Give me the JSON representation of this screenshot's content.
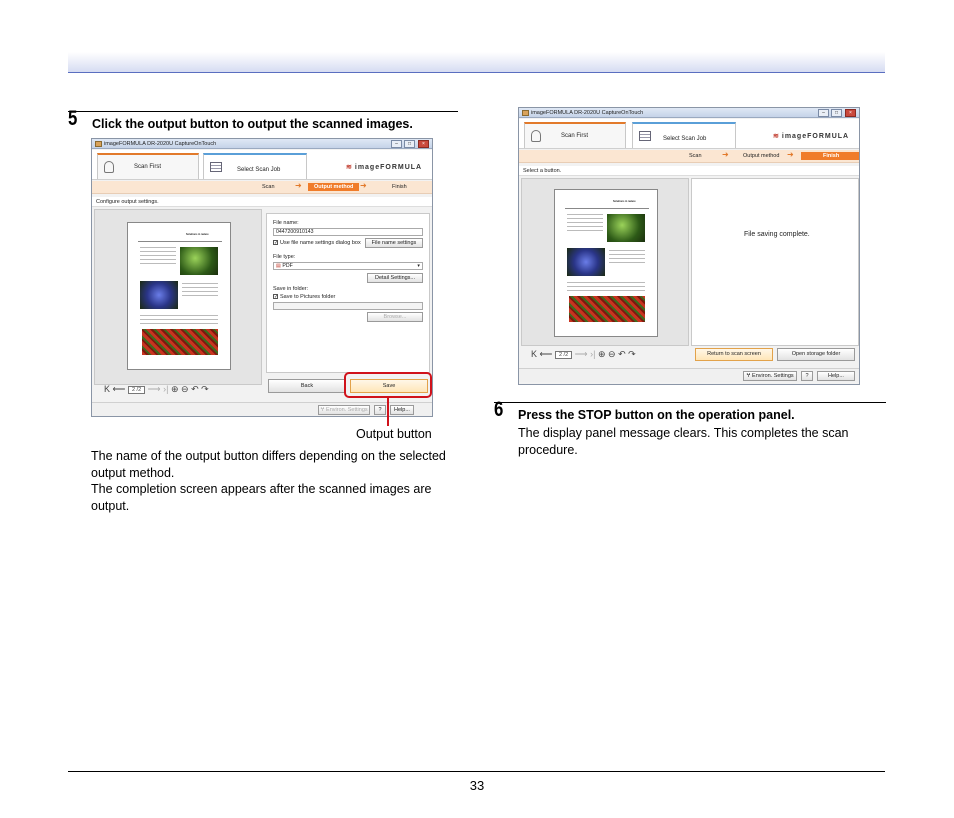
{
  "page": {
    "number": "33"
  },
  "step5": {
    "number": "5",
    "title": "Click the output button to output the scanned images.",
    "callout": "Output button",
    "body": [
      "The name of the output button differs depending on the selected",
      "output method.",
      "The completion screen appears after the scanned images are",
      "output."
    ],
    "screenshot": {
      "window_title": "imageFORMULA DR-2020U CaptureOnTouch",
      "tabs": [
        "Scan First",
        "Select Scan Job"
      ],
      "logo": "imageFORMULA",
      "steps": [
        "Scan",
        "Output method",
        "Finish"
      ],
      "instruction": "Configure output settings.",
      "file_name_label": "File name:",
      "file_name_value": "0447200910143",
      "use_dialog_label": "Use file name settings dialog box",
      "file_name_settings_btn": "File name settings",
      "file_type_label": "File type:",
      "file_type_value": "PDF",
      "detail_settings_btn": "Detail Settings...",
      "save_in_label": "Save in folder:",
      "save_to_pictures_label": "Save to Pictures folder",
      "browse_btn": "Browse...",
      "back_btn": "Back",
      "save_btn": "Save",
      "environ_btn": "Environ. Settings",
      "help_q": "?",
      "help_btn": "Help...",
      "page_counter": "2 /2",
      "doc_heading": "Solutions in nature"
    }
  },
  "step6": {
    "number": "6",
    "title": "Press the STOP button on the operation panel.",
    "body": [
      "The display panel message clears. This completes the scan",
      "procedure."
    ],
    "screenshot": {
      "window_title": "imageFORMULA DR-2020U CaptureOnTouch",
      "tabs": [
        "Scan First",
        "Select Scan Job"
      ],
      "logo": "imageFORMULA",
      "steps": [
        "Scan",
        "Output method",
        "Finish"
      ],
      "instruction": "Select a button.",
      "message": "File saving complete.",
      "return_btn": "Return to scan screen",
      "open_folder_btn": "Open storage folder",
      "environ_btn": "Environ. Settings",
      "help_q": "?",
      "help_btn": "Help...",
      "page_counter": "2 /2",
      "doc_heading": "Solutions in nature"
    }
  }
}
